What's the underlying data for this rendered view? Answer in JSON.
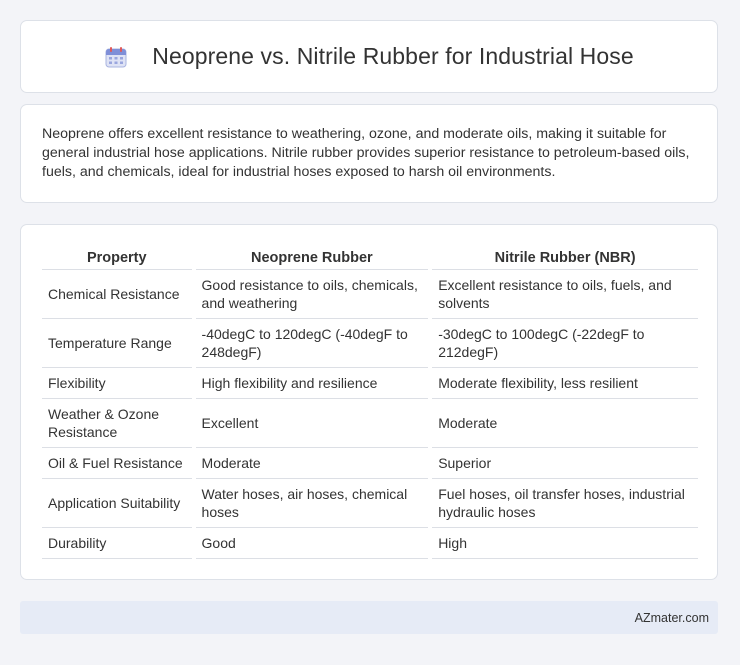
{
  "header": {
    "title": "Neoprene vs. Nitrile Rubber for Industrial Hose",
    "icon": "calendar-icon"
  },
  "intro": {
    "text": "Neoprene offers excellent resistance to weathering, ozone, and moderate oils, making it suitable for general industrial hose applications. Nitrile rubber provides superior resistance to petroleum-based oils, fuels, and chemicals, ideal for industrial hoses exposed to harsh oil environments."
  },
  "table": {
    "headers": [
      "Property",
      "Neoprene Rubber",
      "Nitrile Rubber (NBR)"
    ],
    "rows": [
      [
        "Chemical Resistance",
        "Good resistance to oils, chemicals, and weathering",
        "Excellent resistance to oils, fuels, and solvents"
      ],
      [
        "Temperature Range",
        "-40degC to 120degC (-40degF to 248degF)",
        "-30degC to 100degC (-22degF to 212degF)"
      ],
      [
        "Flexibility",
        "High flexibility and resilience",
        "Moderate flexibility, less resilient"
      ],
      [
        "Weather & Ozone Resistance",
        "Excellent",
        "Moderate"
      ],
      [
        "Oil & Fuel Resistance",
        "Moderate",
        "Superior"
      ],
      [
        "Application Suitability",
        "Water hoses, air hoses, chemical hoses",
        "Fuel hoses, oil transfer hoses, industrial hydraulic hoses"
      ],
      [
        "Durability",
        "Good",
        "High"
      ]
    ]
  },
  "footer": {
    "brand": "AZmater.com"
  }
}
